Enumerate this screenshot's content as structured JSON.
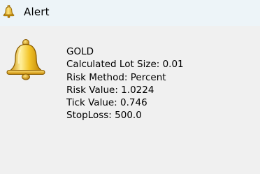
{
  "window": {
    "title": "Alert",
    "title_icon": "bell-icon"
  },
  "message": {
    "icon": "bell-icon",
    "lines": [
      "GOLD",
      "Calculated Lot Size: 0.01",
      "Risk Method: Percent",
      "Risk Value: 1.0224",
      "Tick Value: 0.746",
      "StopLoss: 500.0"
    ]
  },
  "colors": {
    "titlebar_bg": "#edf4f8",
    "body_bg": "#f0f0f0",
    "bell_gold": "#e8b820",
    "bell_outline": "#9a6a08"
  }
}
